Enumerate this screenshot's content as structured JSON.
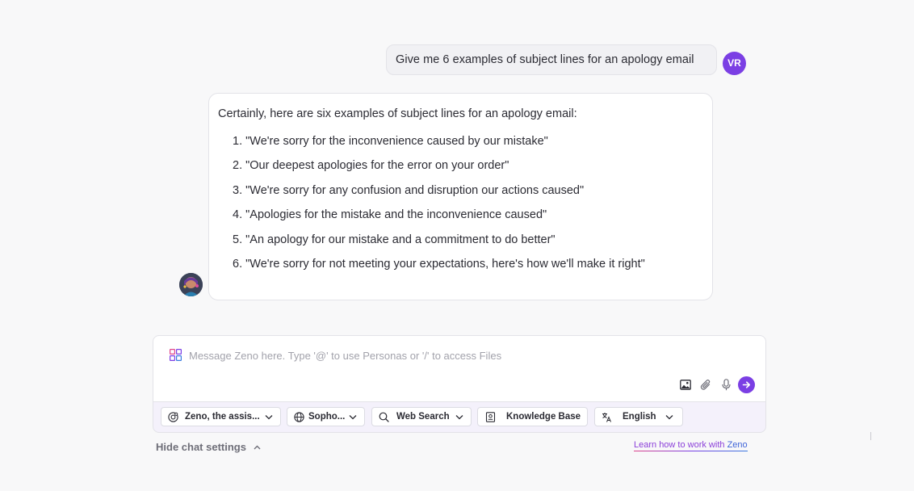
{
  "user_message": {
    "text": "Give me 6 examples of subject lines for an apology email",
    "avatar_initials": "VR",
    "avatar_color": "#7b3fe4"
  },
  "assistant_message": {
    "intro": "Certainly, here are six examples of subject lines for an apology email:",
    "items": [
      "1. \"We're sorry for the inconvenience caused by our mistake\"",
      "2. \"Our deepest apologies for the error on your order\"",
      "3. \"We're sorry for any confusion and disruption our actions caused\"",
      "4. \"Apologies for the mistake and the inconvenience caused\"",
      "5. \"An apology for our mistake and a commitment to do better\"",
      "6. \"We're sorry for not meeting your expectations, here's how we'll make it right\""
    ]
  },
  "composer": {
    "placeholder": "Message Zeno here. Type '@' to use Personas or '/' to access Files",
    "value": ""
  },
  "settings": {
    "persona": "Zeno, the assis...",
    "model": "Sopho...",
    "web_search": "Web Search",
    "knowledge_base": "Knowledge Base",
    "language": "English"
  },
  "footer": {
    "hide_settings": "Hide chat settings",
    "learn_prefix": "Learn how to work with ",
    "learn_brand": "Zeno"
  },
  "colors": {
    "accent": "#7b3fe4",
    "link": "#8b3fd9"
  }
}
